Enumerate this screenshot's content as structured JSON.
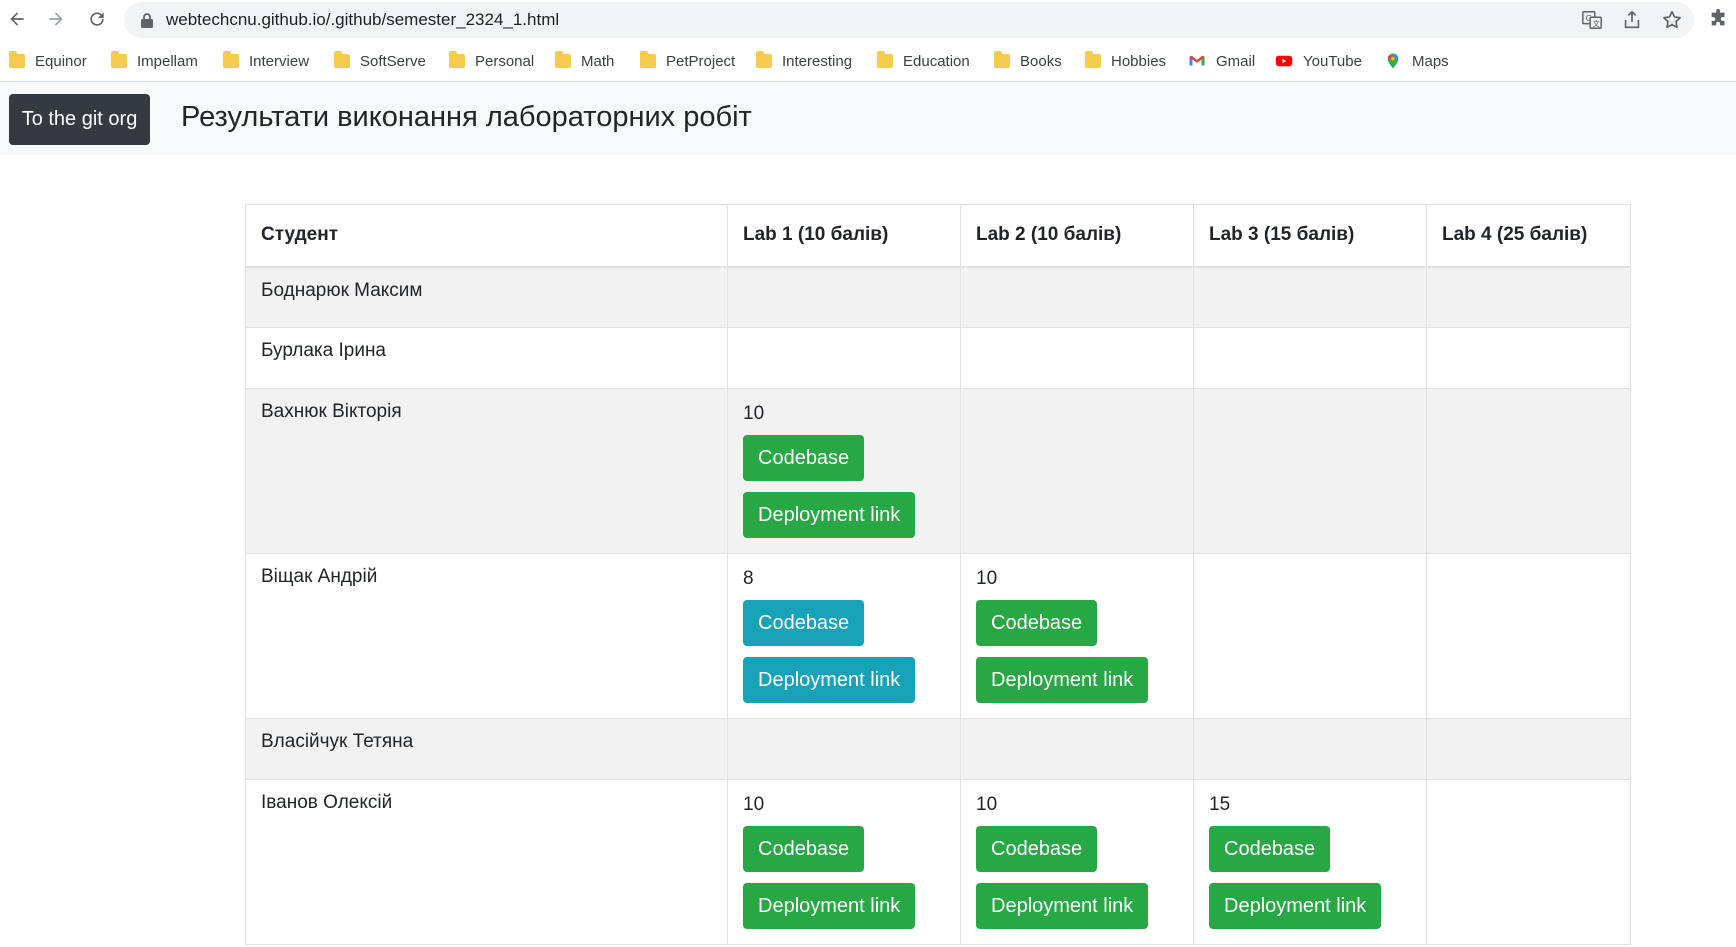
{
  "browser": {
    "url": "webtechcnu.github.io/.github/semester_2324_1.html",
    "bookmarks": [
      {
        "label": "Equinor",
        "icon": "folder-icon"
      },
      {
        "label": "Impellam",
        "icon": "folder-icon"
      },
      {
        "label": "Interview",
        "icon": "folder-icon"
      },
      {
        "label": "SoftServe",
        "icon": "folder-icon"
      },
      {
        "label": "Personal",
        "icon": "folder-icon"
      },
      {
        "label": "Math",
        "icon": "folder-icon"
      },
      {
        "label": "PetProject",
        "icon": "folder-icon"
      },
      {
        "label": "Interesting",
        "icon": "folder-icon"
      },
      {
        "label": "Education",
        "icon": "folder-icon"
      },
      {
        "label": "Books",
        "icon": "folder-icon"
      },
      {
        "label": "Hobbies",
        "icon": "folder-icon"
      },
      {
        "label": "Gmail",
        "icon": "gmail-icon"
      },
      {
        "label": "YouTube",
        "icon": "youtube-icon"
      },
      {
        "label": "Maps",
        "icon": "maps-icon"
      }
    ]
  },
  "header": {
    "git_button": "To the git org",
    "title": "Результати виконання лабораторних робіт"
  },
  "table": {
    "columns": [
      "Студент",
      "Lab 1 (10 балів)",
      "Lab 2 (10 балів)",
      "Lab 3 (15 балів)",
      "Lab 4 (25 балів)"
    ],
    "rows": [
      {
        "student": "Боднарюк Максим",
        "labs": [
          null,
          null,
          null,
          null
        ]
      },
      {
        "student": "Бурлака Ірина",
        "labs": [
          null,
          null,
          null,
          null
        ]
      },
      {
        "student": "Вахнюк Вікторія",
        "labs": [
          {
            "score": "10",
            "codebase": "Codebase",
            "deployment": "Deployment link",
            "style": "success"
          },
          null,
          null,
          null
        ]
      },
      {
        "student": "Віщак Андрій",
        "labs": [
          {
            "score": "8",
            "codebase": "Codebase",
            "deployment": "Deployment link",
            "style": "info"
          },
          {
            "score": "10",
            "codebase": "Codebase",
            "deployment": "Deployment link",
            "style": "success"
          },
          null,
          null
        ]
      },
      {
        "student": "Власійчук Тетяна",
        "labs": [
          null,
          null,
          null,
          null
        ]
      },
      {
        "student": "Іванов Олексій",
        "labs": [
          {
            "score": "10",
            "codebase": "Codebase",
            "deployment": "Deployment link",
            "style": "success"
          },
          {
            "score": "10",
            "codebase": "Codebase",
            "deployment": "Deployment link",
            "style": "success"
          },
          {
            "score": "15",
            "codebase": "Codebase",
            "deployment": "Deployment link",
            "style": "success"
          },
          null
        ]
      }
    ]
  },
  "colors": {
    "success": "#28a745",
    "info": "#17a2b8",
    "dark": "#343a40",
    "stripe": "#f2f2f2"
  }
}
